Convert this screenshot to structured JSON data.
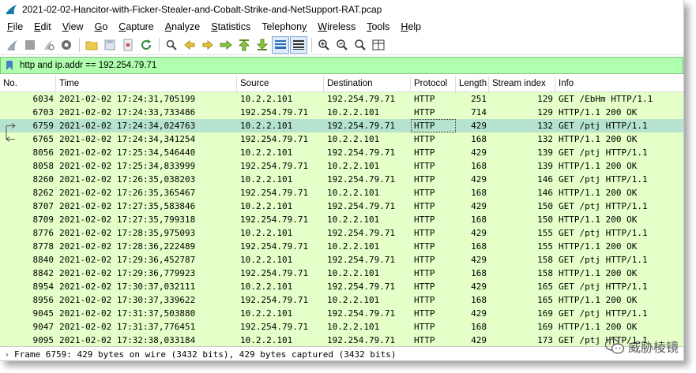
{
  "window": {
    "title": "2021-02-02-Hancitor-with-Ficker-Stealer-and-Cobalt-Strike-and-NetSupport-RAT.pcap"
  },
  "menu": [
    {
      "pre": "",
      "ul": "F",
      "post": "ile"
    },
    {
      "pre": "",
      "ul": "E",
      "post": "dit"
    },
    {
      "pre": "",
      "ul": "V",
      "post": "iew"
    },
    {
      "pre": "",
      "ul": "G",
      "post": "o"
    },
    {
      "pre": "",
      "ul": "C",
      "post": "apture"
    },
    {
      "pre": "",
      "ul": "A",
      "post": "nalyze"
    },
    {
      "pre": "",
      "ul": "S",
      "post": "tatistics"
    },
    {
      "pre": "Telephon",
      "ul": "y",
      "post": ""
    },
    {
      "pre": "",
      "ul": "W",
      "post": "ireless"
    },
    {
      "pre": "",
      "ul": "T",
      "post": "ools"
    },
    {
      "pre": "",
      "ul": "H",
      "post": "elp"
    }
  ],
  "filter": {
    "value": "http and ip.addr == 192.254.79.71",
    "color": "#afffaf"
  },
  "columns": [
    "No.",
    "Time",
    "Source",
    "Destination",
    "Protocol",
    "Length",
    "Stream index",
    "Info"
  ],
  "packets": [
    {
      "no": "6034",
      "time": "2021-02-02 17:24:31,705199",
      "src": "10.2.2.101",
      "dst": "192.254.79.71",
      "proto": "HTTP",
      "len": "251",
      "stream": "129",
      "info": "GET /EbHm HTTP/1.1"
    },
    {
      "no": "6703",
      "time": "2021-02-02 17:24:33,733486",
      "src": "192.254.79.71",
      "dst": "10.2.2.101",
      "proto": "HTTP",
      "len": "714",
      "stream": "129",
      "info": "HTTP/1.1 200 OK"
    },
    {
      "no": "6759",
      "time": "2021-02-02 17:24:34,024763",
      "src": "10.2.2.101",
      "dst": "192.254.79.71",
      "proto": "HTTP",
      "len": "429",
      "stream": "132",
      "info": "GET /ptj HTTP/1.1",
      "selected": true,
      "marker": "request"
    },
    {
      "no": "6765",
      "time": "2021-02-02 17:24:34,341254",
      "src": "192.254.79.71",
      "dst": "10.2.2.101",
      "proto": "HTTP",
      "len": "168",
      "stream": "132",
      "info": "HTTP/1.1 200 OK",
      "marker": "response"
    },
    {
      "no": "8056",
      "time": "2021-02-02 17:25:34,546440",
      "src": "10.2.2.101",
      "dst": "192.254.79.71",
      "proto": "HTTP",
      "len": "429",
      "stream": "139",
      "info": "GET /ptj HTTP/1.1"
    },
    {
      "no": "8058",
      "time": "2021-02-02 17:25:34,833999",
      "src": "192.254.79.71",
      "dst": "10.2.2.101",
      "proto": "HTTP",
      "len": "168",
      "stream": "139",
      "info": "HTTP/1.1 200 OK"
    },
    {
      "no": "8260",
      "time": "2021-02-02 17:26:35,038203",
      "src": "10.2.2.101",
      "dst": "192.254.79.71",
      "proto": "HTTP",
      "len": "429",
      "stream": "146",
      "info": "GET /ptj HTTP/1.1"
    },
    {
      "no": "8262",
      "time": "2021-02-02 17:26:35,365467",
      "src": "192.254.79.71",
      "dst": "10.2.2.101",
      "proto": "HTTP",
      "len": "168",
      "stream": "146",
      "info": "HTTP/1.1 200 OK"
    },
    {
      "no": "8707",
      "time": "2021-02-02 17:27:35,583846",
      "src": "10.2.2.101",
      "dst": "192.254.79.71",
      "proto": "HTTP",
      "len": "429",
      "stream": "150",
      "info": "GET /ptj HTTP/1.1"
    },
    {
      "no": "8709",
      "time": "2021-02-02 17:27:35,799318",
      "src": "192.254.79.71",
      "dst": "10.2.2.101",
      "proto": "HTTP",
      "len": "168",
      "stream": "150",
      "info": "HTTP/1.1 200 OK"
    },
    {
      "no": "8776",
      "time": "2021-02-02 17:28:35,975093",
      "src": "10.2.2.101",
      "dst": "192.254.79.71",
      "proto": "HTTP",
      "len": "429",
      "stream": "155",
      "info": "GET /ptj HTTP/1.1"
    },
    {
      "no": "8778",
      "time": "2021-02-02 17:28:36,222489",
      "src": "192.254.79.71",
      "dst": "10.2.2.101",
      "proto": "HTTP",
      "len": "168",
      "stream": "155",
      "info": "HTTP/1.1 200 OK"
    },
    {
      "no": "8840",
      "time": "2021-02-02 17:29:36,452787",
      "src": "10.2.2.101",
      "dst": "192.254.79.71",
      "proto": "HTTP",
      "len": "429",
      "stream": "158",
      "info": "GET /ptj HTTP/1.1"
    },
    {
      "no": "8842",
      "time": "2021-02-02 17:29:36,779923",
      "src": "192.254.79.71",
      "dst": "10.2.2.101",
      "proto": "HTTP",
      "len": "168",
      "stream": "158",
      "info": "HTTP/1.1 200 OK"
    },
    {
      "no": "8954",
      "time": "2021-02-02 17:30:37,032111",
      "src": "10.2.2.101",
      "dst": "192.254.79.71",
      "proto": "HTTP",
      "len": "429",
      "stream": "165",
      "info": "GET /ptj HTTP/1.1"
    },
    {
      "no": "8956",
      "time": "2021-02-02 17:30:37,339622",
      "src": "192.254.79.71",
      "dst": "10.2.2.101",
      "proto": "HTTP",
      "len": "168",
      "stream": "165",
      "info": "HTTP/1.1 200 OK"
    },
    {
      "no": "9045",
      "time": "2021-02-02 17:31:37,503880",
      "src": "10.2.2.101",
      "dst": "192.254.79.71",
      "proto": "HTTP",
      "len": "429",
      "stream": "169",
      "info": "GET /ptj HTTP/1.1"
    },
    {
      "no": "9047",
      "time": "2021-02-02 17:31:37,776451",
      "src": "192.254.79.71",
      "dst": "10.2.2.101",
      "proto": "HTTP",
      "len": "168",
      "stream": "169",
      "info": "HTTP/1.1 200 OK"
    },
    {
      "no": "9095",
      "time": "2021-02-02 17:32:38,033184",
      "src": "10.2.2.101",
      "dst": "192.254.79.71",
      "proto": "HTTP",
      "len": "429",
      "stream": "173",
      "info": "GET /ptj HTTP/1.1"
    }
  ],
  "detail": {
    "text": "Frame 6759: 429 bytes on wire (3432 bits), 429 bytes captured (3432 bits)"
  },
  "watermark": {
    "text": "威胁棱镜"
  },
  "colors": {
    "row_bg": "#e4ffc7",
    "selected_bg": "#b5e3cf",
    "filter_bg": "#afffaf"
  }
}
